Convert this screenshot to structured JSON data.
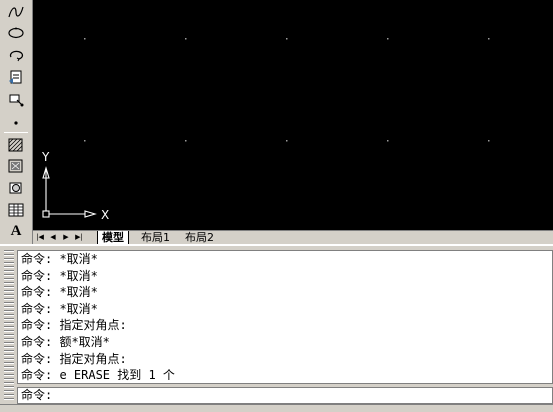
{
  "toolbar": {
    "tools": [
      "spline-icon",
      "ellipse-icon",
      "ellipse-arc-icon",
      "insert-block-icon",
      "make-block-icon",
      "point-icon",
      "hatch-icon",
      "gradient-icon",
      "region-icon",
      "table-icon",
      "multiline-text-icon"
    ],
    "text_tool_label": "A"
  },
  "ucs": {
    "y_label": "Y",
    "x_label": "X"
  },
  "tabs": {
    "nav": [
      "|◀",
      "◀",
      "▶",
      "▶|"
    ],
    "model": "模型",
    "layout1": "布局1",
    "layout2": "布局2"
  },
  "command": {
    "history": [
      "命令: *取消*",
      "命令: *取消*",
      "命令: *取消*",
      "命令: *取消*",
      "命令: 指定对角点:",
      "命令: 额*取消*",
      "命令: 指定对角点:",
      "命令: e ERASE 找到 1 个"
    ],
    "prompt": "命令:"
  },
  "colors": {
    "drawing_bg": "#000000",
    "chrome": "#d4d0c8",
    "grid": "#9a9a9a",
    "ucs": "#ffffff"
  }
}
